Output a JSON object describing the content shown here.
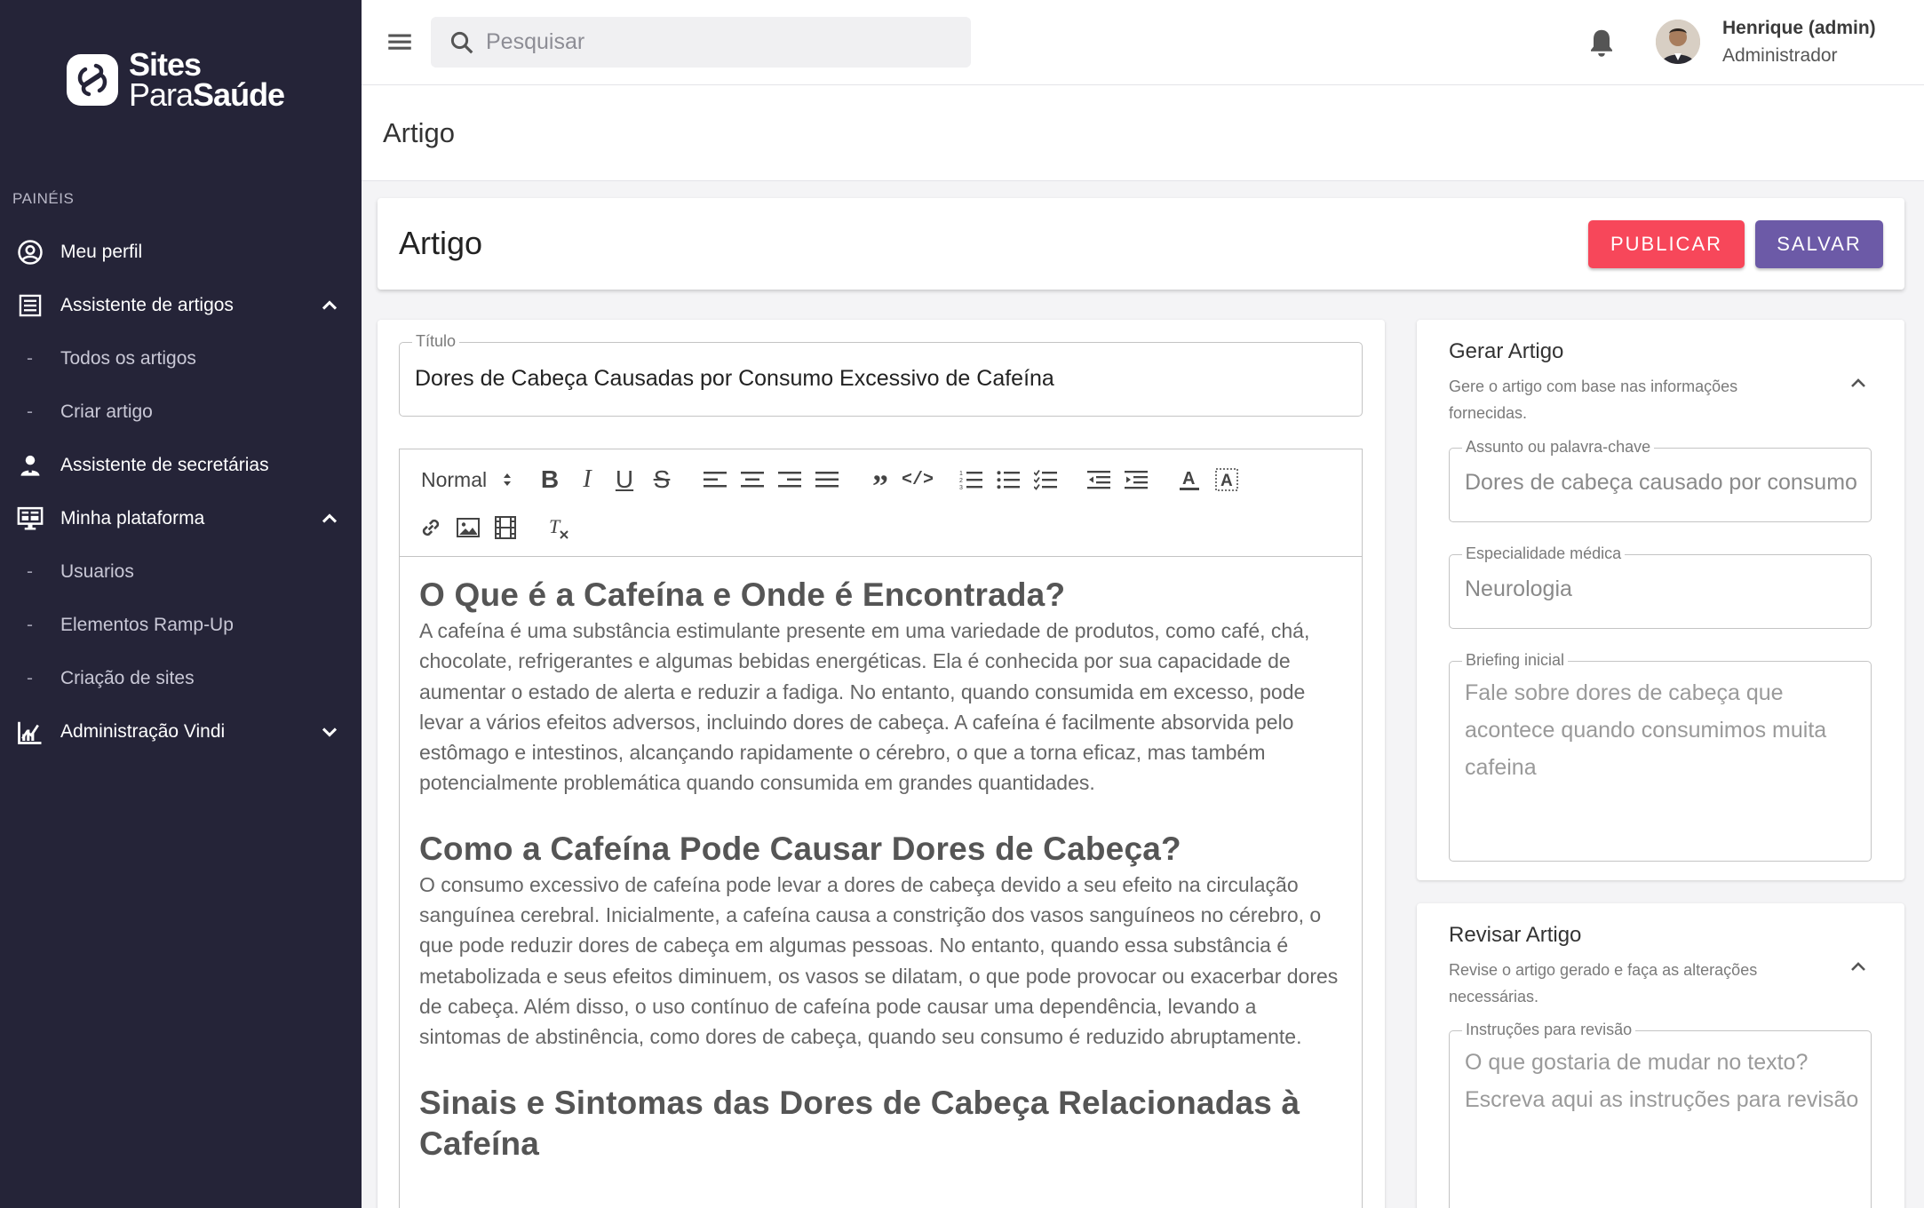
{
  "brand": {
    "line1": "Sites",
    "line2_a": "Para",
    "line2_b": "Saúde"
  },
  "sidebar": {
    "section_label": "PAINÉIS",
    "items": [
      {
        "label": "Meu perfil"
      },
      {
        "label": "Assistente de artigos"
      },
      {
        "label": "Todos os artigos"
      },
      {
        "label": "Criar artigo"
      },
      {
        "label": "Assistente de secretárias"
      },
      {
        "label": "Minha plataforma"
      },
      {
        "label": "Usuarios"
      },
      {
        "label": "Elementos Ramp-Up"
      },
      {
        "label": "Criação de sites"
      },
      {
        "label": "Administração Vindi"
      }
    ]
  },
  "topbar": {
    "search_placeholder": "Pesquisar",
    "user_name": "Henrique (admin)",
    "user_role": "Administrador"
  },
  "page": {
    "title": "Artigo"
  },
  "header_card": {
    "title": "Artigo",
    "publish_label": "PUBLICAR",
    "save_label": "SALVAR"
  },
  "editor": {
    "title_legend": "Título",
    "title_value": "Dores de Cabeça Causadas por Consumo Excessivo de Cafeína",
    "format_select": "Normal",
    "content": {
      "h1": "O Que é a Cafeína e Onde é Encontrada?",
      "p1": "A cafeína é uma substância estimulante presente em uma variedade de produtos, como café, chá, chocolate, refrigerantes e algumas bebidas energéticas. Ela é conhecida por sua capacidade de aumentar o estado de alerta e reduzir a fadiga. No entanto, quando consumida em excesso, pode levar a vários efeitos adversos, incluindo dores de cabeça. A cafeína é facilmente absorvida pelo estômago e intestinos, alcançando rapidamente o cérebro, o que a torna eficaz, mas também potencialmente problemática quando consumida em grandes quantidades.",
      "h2": "Como a Cafeína Pode Causar Dores de Cabeça?",
      "p2": "O consumo excessivo de cafeína pode levar a dores de cabeça devido a seu efeito na circulação sanguínea cerebral. Inicialmente, a cafeína causa a constrição dos vasos sanguíneos no cérebro, o que pode reduzir dores de cabeça em algumas pessoas. No entanto, quando essa substância é metabolizada e seus efeitos diminuem, os vasos se dilatam, o que pode provocar ou exacerbar dores de cabeça. Além disso, o uso contínuo de cafeína pode causar uma dependência, levando a sintomas de abstinência, como dores de cabeça, quando seu consumo é reduzido abruptamente.",
      "h3": "Sinais e Sintomas das Dores de Cabeça Relacionadas à Cafeína"
    }
  },
  "generate": {
    "title": "Gerar Artigo",
    "description": "Gere o artigo com base nas informações fornecidas.",
    "topic_legend": "Assunto ou palavra-chave",
    "topic_value": "Dores de cabeça causado por consumo de cafeína",
    "specialty_legend": "Especialidade médica",
    "specialty_value": "Neurologia",
    "briefing_legend": "Briefing inicial",
    "briefing_value": "Fale sobre dores de cabeça que acontece quando consumimos muita cafeina"
  },
  "review": {
    "title": "Revisar Artigo",
    "description": "Revise o artigo gerado e faça as alterações necessárias.",
    "instructions_legend": "Instruções para revisão",
    "instructions_placeholder": "O que gostaria de mudar no texto? Escreva aqui as instruções para revisão"
  },
  "colors": {
    "sidebar_bg": "#252438",
    "publish": "#f7475a",
    "save": "#6c5aa7"
  }
}
